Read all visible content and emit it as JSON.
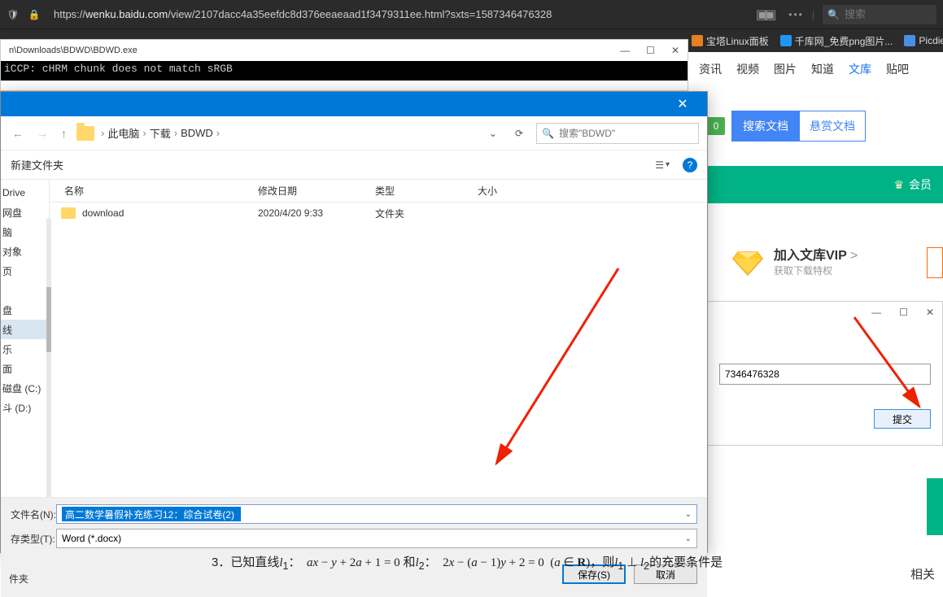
{
  "browser": {
    "url_prefix": "https://",
    "url_host": "wenku.baidu.com",
    "url_path": "/view/2107dacc4a35eefdc8d376eeaeaad1f3479311ee.html?sxts=1587346476328",
    "search_placeholder": "搜索"
  },
  "bookmarks": {
    "item1": "宝塔Linux面板",
    "item2": "千库网_免费png图片...",
    "item3": "Picdie"
  },
  "console": {
    "title_path": "n\\Downloads\\BDWD\\BDWD.exe",
    "output": "iCCP: cHRM chunk does not match sRGB"
  },
  "baidu_nav": {
    "n1": "资讯",
    "n2": "视频",
    "n3": "图片",
    "n4": "知道",
    "n5": "文库",
    "n6": "贴吧"
  },
  "baidu_search": {
    "badge": "0",
    "btn1": "搜索文档",
    "btn2": "悬赏文档"
  },
  "green_strip": {
    "text": "会员"
  },
  "vip": {
    "title": "加入文库VIP",
    "arrow": ">",
    "sub": "获取下载特权"
  },
  "submit_window": {
    "input_value": "7346476328",
    "button": "提交"
  },
  "save_dialog": {
    "breadcrumb": {
      "pc": "此电脑",
      "dl": "下载",
      "folder": "BDWD"
    },
    "search_placeholder": "搜索\"BDWD\"",
    "new_folder": "新建文件夹",
    "columns": {
      "name": "名称",
      "date": "修改日期",
      "type": "类型",
      "size": "大小"
    },
    "rows": [
      {
        "name": "download",
        "date": "2020/4/20 9:33",
        "type": "文件夹",
        "size": ""
      }
    ],
    "sidebar": {
      "i0": "Drive",
      "i1": "网盘",
      "i2": "脑",
      "i3": "对象",
      "i4": "页",
      "i5": "",
      "i6": "盘",
      "i7": "线",
      "i8": "乐",
      "i9": "面",
      "i10": "磁盘 (C:)",
      "i11": "斗 (D:)"
    },
    "filename_label": "文件名(N):",
    "filename_value": "高二数学暑假补充练习12：综合试卷(2)",
    "filetype_label": "存类型(T):",
    "filetype_value": "Word (*.docx)",
    "hide_folders": "件夹",
    "save_btn": "保存(S)",
    "cancel_btn": "取消"
  },
  "math": {
    "prefix": "3．已知直线",
    "l1": "l",
    "sub1": "1",
    "colon": "：",
    "eq1": "ax − y + 2a + 1 = 0",
    "and": "和",
    "l2": "l",
    "sub2": "2",
    "eq2": "2x − (a − 1)y + 2 = 0",
    "paren": "(a ∈ ℝ)",
    "then": "，则",
    "perp": "l₁ ⊥ l₂",
    "end": "的充要条件是"
  },
  "related": "相关"
}
